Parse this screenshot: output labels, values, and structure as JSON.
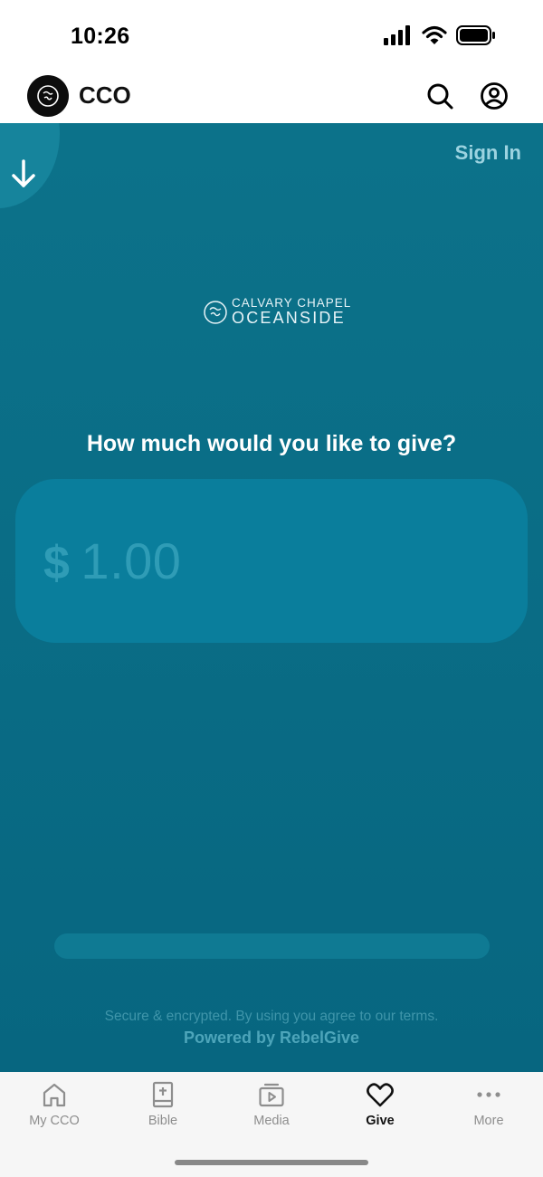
{
  "status_bar": {
    "time": "10:26"
  },
  "header": {
    "title": "CCO",
    "search_icon": "search-icon",
    "account_icon": "account-icon"
  },
  "give": {
    "sign_in": "Sign In",
    "org_line1": "CALVARY CHAPEL",
    "org_line2": "OCEANSIDE",
    "question": "How much would you like to give?",
    "currency": "$",
    "amount_placeholder": "1.00",
    "footer_note": "Secure & encrypted. By using you agree to our terms.",
    "powered_by": "Powered by RebelGive"
  },
  "tabs": [
    {
      "label": "My CCO",
      "icon": "home-icon",
      "active": false
    },
    {
      "label": "Bible",
      "icon": "bible-icon",
      "active": false
    },
    {
      "label": "Media",
      "icon": "media-icon",
      "active": false
    },
    {
      "label": "Give",
      "icon": "heart-icon",
      "active": true
    },
    {
      "label": "More",
      "icon": "more-icon",
      "active": false
    }
  ],
  "colors": {
    "panel": "#0a6d86",
    "accent_text": "#9cd3e0",
    "active_tab": "#111111",
    "inactive_tab": "#8e8e8e"
  }
}
